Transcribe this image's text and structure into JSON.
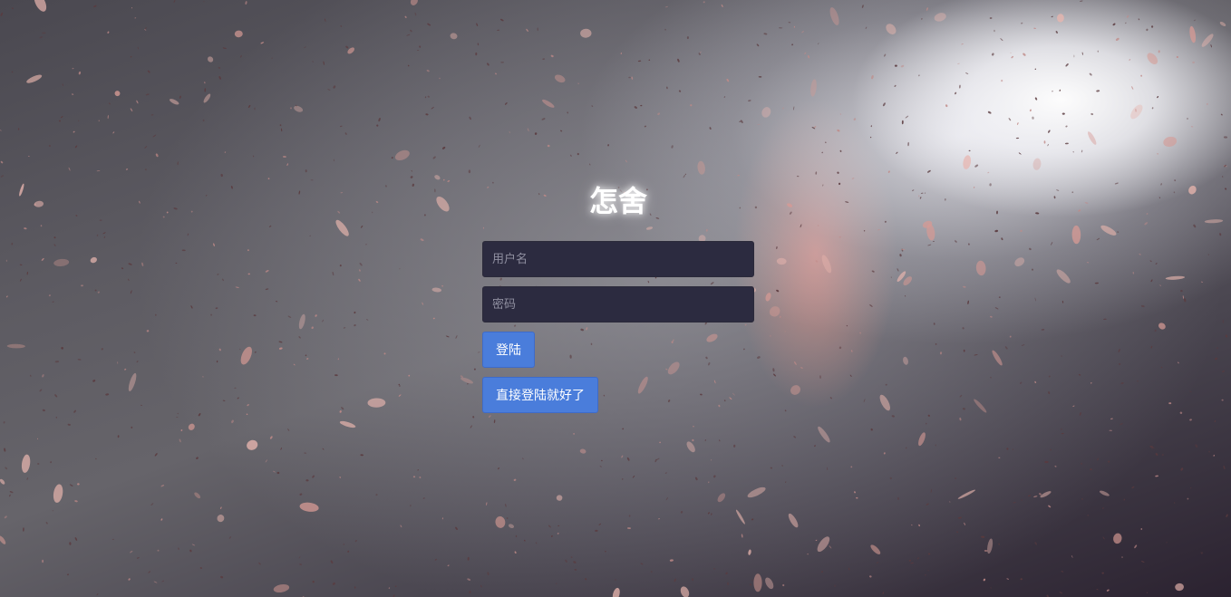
{
  "app": {
    "title": "怎舍"
  },
  "form": {
    "username_placeholder": "用户名",
    "username_value": "",
    "password_placeholder": "密码",
    "password_value": "",
    "login_label": "登陆",
    "direct_login_label": "直接登陆就好了"
  },
  "colors": {
    "button": "#4a7ddb",
    "input_bg": "#2c2b40",
    "title": "#ffffff"
  }
}
